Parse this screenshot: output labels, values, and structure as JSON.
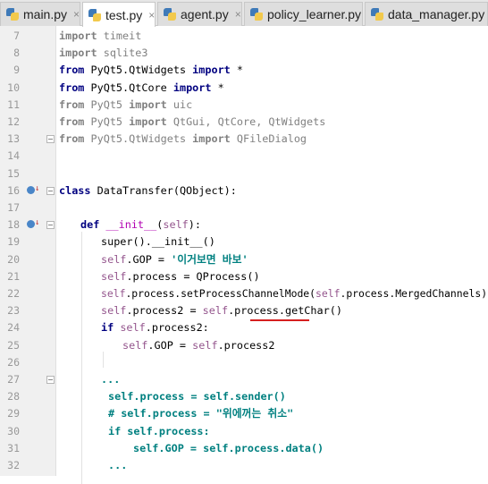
{
  "tabs": [
    {
      "label": "main.py"
    },
    {
      "label": "test.py"
    },
    {
      "label": "agent.py"
    },
    {
      "label": "policy_learner.py"
    },
    {
      "label": "data_manager.py"
    }
  ],
  "active_tab": "test.py",
  "close_glyph": "×",
  "annotation_color": "#d61f1f",
  "lines": [
    {
      "n": "7"
    },
    {
      "n": "8"
    },
    {
      "n": "9"
    },
    {
      "n": "10"
    },
    {
      "n": "11"
    },
    {
      "n": "12"
    },
    {
      "n": "13"
    },
    {
      "n": "14"
    },
    {
      "n": "15"
    },
    {
      "n": "16"
    },
    {
      "n": "17"
    },
    {
      "n": "18"
    },
    {
      "n": "19"
    },
    {
      "n": "20"
    },
    {
      "n": "21"
    },
    {
      "n": "22"
    },
    {
      "n": "23"
    },
    {
      "n": "24"
    },
    {
      "n": "25"
    },
    {
      "n": "26"
    },
    {
      "n": "27"
    },
    {
      "n": "28"
    },
    {
      "n": "29"
    },
    {
      "n": "30"
    },
    {
      "n": "31"
    },
    {
      "n": "32"
    }
  ],
  "code": {
    "l7": {
      "kw": "import",
      "rest": " timeit"
    },
    "l8": {
      "kw": "import",
      "rest": " sqlite3"
    },
    "l9": {
      "kw1": "from",
      "mid": " PyQt5.QtWidgets ",
      "kw2": "import",
      "rest": " *"
    },
    "l10": {
      "kw1": "from",
      "mid": " PyQt5.QtCore ",
      "kw2": "import",
      "rest": " *"
    },
    "l11": {
      "kw1": "from",
      "mid": " PyQt5 ",
      "kw2": "import",
      "rest": " uic"
    },
    "l12": {
      "kw1": "from",
      "mid": " PyQt5 ",
      "kw2": "import",
      "rest": " QtGui, QtCore, QtWidgets"
    },
    "l13": {
      "kw1": "from",
      "mid": " PyQt5.QtWidgets ",
      "kw2": "import",
      "rest": " QFileDialog"
    },
    "l16": {
      "kw": "class",
      "rest": " DataTransfer(QObject):"
    },
    "l18": {
      "kw": "def",
      "sp": " ",
      "name": "__init__",
      "open": "(",
      "self": "self",
      "close": "):"
    },
    "l19": {
      "text": "super().__init__()"
    },
    "l20": {
      "self": "self",
      "mid": ".GOP = ",
      "str": "'이거보면 바보'"
    },
    "l21": {
      "self": "self",
      "rest": ".process = QProcess()"
    },
    "l22": {
      "self1": "self",
      "mid": ".process.setProcessChannelMode(",
      "self2": "self",
      "rest": ".process.MergedChannels)"
    },
    "l23": {
      "self1": "self",
      "mid": ".process2 = ",
      "self2": "self",
      "rest1": ".process.",
      "rest2": "getChar()"
    },
    "l24": {
      "kw": "if",
      "sp": " ",
      "self": "self",
      "rest": ".process2:"
    },
    "l25": {
      "self": "self",
      "rest": ".GOP = ",
      "self2": "self",
      "rest2": ".process2"
    },
    "l27": {
      "text": "..."
    },
    "l28": {
      "text": "self.process = self.sender()"
    },
    "l29": {
      "text": "# self.process = \"위에꺼는 취소\""
    },
    "l30": {
      "text": "if self.process:"
    },
    "l31": {
      "text": "self.GOP = self.process.data()"
    },
    "l32": {
      "text": "..."
    }
  }
}
